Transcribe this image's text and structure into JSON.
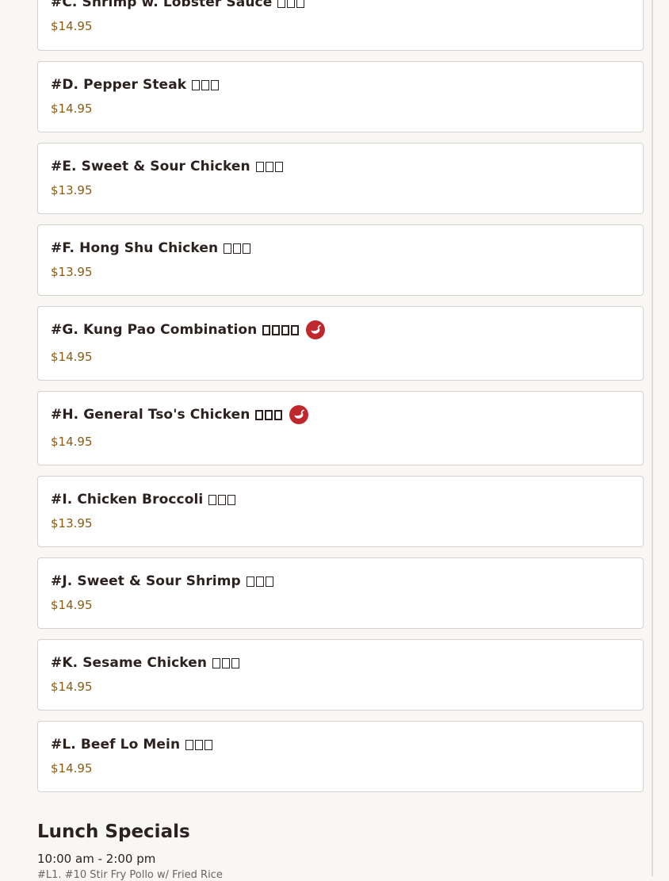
{
  "menu_items": [
    {
      "name": "#C. Shrimp w. Lobster Sauce",
      "chinese": "□□□",
      "price": "$14.95",
      "spicy": false
    },
    {
      "name": "#D. Pepper Steak",
      "chinese": "□□□",
      "price": "$14.95",
      "spicy": false
    },
    {
      "name": "#E. Sweet & Sour Chicken",
      "chinese": "□□□",
      "price": "$13.95",
      "spicy": false
    },
    {
      "name": "#F. Hong Shu Chicken",
      "chinese": "□□□",
      "price": "$13.95",
      "spicy": false
    },
    {
      "name": "#G. Kung Pao Combination",
      "chinese": "□□□□",
      "price": "$14.95",
      "spicy": true
    },
    {
      "name": "#H. General Tso's Chicken",
      "chinese": "□□□",
      "price": "$14.95",
      "spicy": true
    },
    {
      "name": "#I. Chicken Broccoli",
      "chinese": "□□□",
      "price": "$13.95",
      "spicy": false
    },
    {
      "name": "#J. Sweet & Sour Shrimp",
      "chinese": "□□□",
      "price": "$14.95",
      "spicy": false
    },
    {
      "name": "#K. Sesame Chicken",
      "chinese": "□□□",
      "price": "$14.95",
      "spicy": false
    },
    {
      "name": "#L. Beef Lo Mein",
      "chinese": "□□□",
      "price": "$14.95",
      "spicy": false
    }
  ],
  "spicy_icon": "chili-pepper-icon",
  "colors": {
    "price": "#8a5b13",
    "spicy_badge": "#c0272d",
    "card_border": "#d6d2cf"
  },
  "lunch_section": {
    "title": "Lunch Specials",
    "hours": "10:00 am - 2:00 pm",
    "cutoff_text": "#L1. #10 Stir Fry Pollo w/ Fried Rice"
  }
}
